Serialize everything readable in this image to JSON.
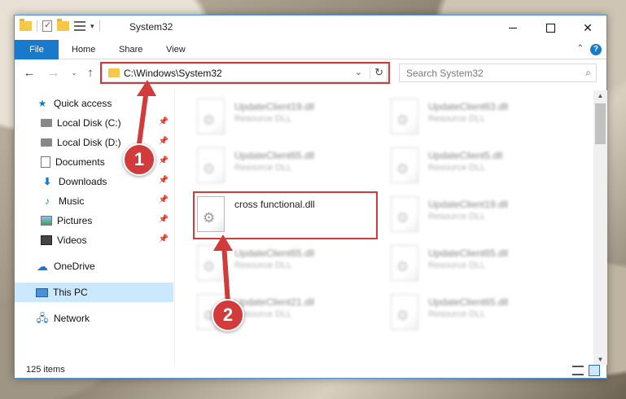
{
  "window": {
    "title": "System32",
    "controls": {
      "minimize": "",
      "maximize": "",
      "close": "✕"
    }
  },
  "ribbon": {
    "tabs": [
      "File",
      "Home",
      "Share",
      "View"
    ],
    "help": "?",
    "collapse": "⌃"
  },
  "navigation": {
    "back": "←",
    "forward": "→",
    "recent": "⌄",
    "up": "↑",
    "address": "C:\\Windows\\System32",
    "address_dropdown": "⌄",
    "refresh": "↻",
    "search_placeholder": "Search System32",
    "search_icon": "⌕"
  },
  "sidebar": {
    "items": [
      {
        "label": "Quick access",
        "icon": "star-icon",
        "glyph": "★",
        "pinned": false
      },
      {
        "label": "Local Disk (C:)",
        "icon": "drive-icon",
        "pinned": true
      },
      {
        "label": "Local Disk (D:)",
        "icon": "drive-icon",
        "pinned": true
      },
      {
        "label": "Documents",
        "icon": "documents-icon",
        "pinned": true
      },
      {
        "label": "Downloads",
        "icon": "downloads-icon",
        "glyph": "⬇",
        "pinned": true
      },
      {
        "label": "Music",
        "icon": "music-icon",
        "glyph": "♪",
        "pinned": true
      },
      {
        "label": "Pictures",
        "icon": "pictures-icon",
        "pinned": true
      },
      {
        "label": "Videos",
        "icon": "videos-icon",
        "pinned": true
      },
      {
        "label": "OneDrive",
        "icon": "onedrive-icon",
        "glyph": "☁",
        "pinned": false
      },
      {
        "label": "This PC",
        "icon": "computer-icon",
        "pinned": false,
        "selected": true
      },
      {
        "label": "Network",
        "icon": "network-icon",
        "glyph": "🖧",
        "pinned": false
      }
    ],
    "pin_glyph": "📌"
  },
  "files": [
    {
      "name": "UpdateClient19.dll",
      "type": "Resource DLL",
      "blurred": true
    },
    {
      "name": "UpdateClient63.dll",
      "type": "Resource DLL",
      "blurred": true
    },
    {
      "name": "UpdateClient65.dll",
      "type": "Resource DLL",
      "blurred": true
    },
    {
      "name": "UpdateClient5.dll",
      "type": "Resource DLL",
      "blurred": true
    },
    {
      "name": "cross functional.dll",
      "type": "",
      "blurred": false,
      "highlighted": true
    },
    {
      "name": "UpdateClient19.dll",
      "type": "Resource DLL",
      "blurred": true
    },
    {
      "name": "UpdateClient65.dll",
      "type": "Resource DLL",
      "blurred": true
    },
    {
      "name": "UpdateClient65.dll",
      "type": "Resource DLL",
      "blurred": true
    },
    {
      "name": "UpdateClient21.dll",
      "type": "Resource DLL",
      "blurred": true
    },
    {
      "name": "UpdateClient65.dll",
      "type": "Resource DLL",
      "blurred": true
    }
  ],
  "status": {
    "item_count": "125 items"
  },
  "scrollbar": {
    "up": "▲",
    "down": "▼"
  },
  "annotations": {
    "step1": "1",
    "step2": "2",
    "accent_color": "#d23b3b"
  }
}
